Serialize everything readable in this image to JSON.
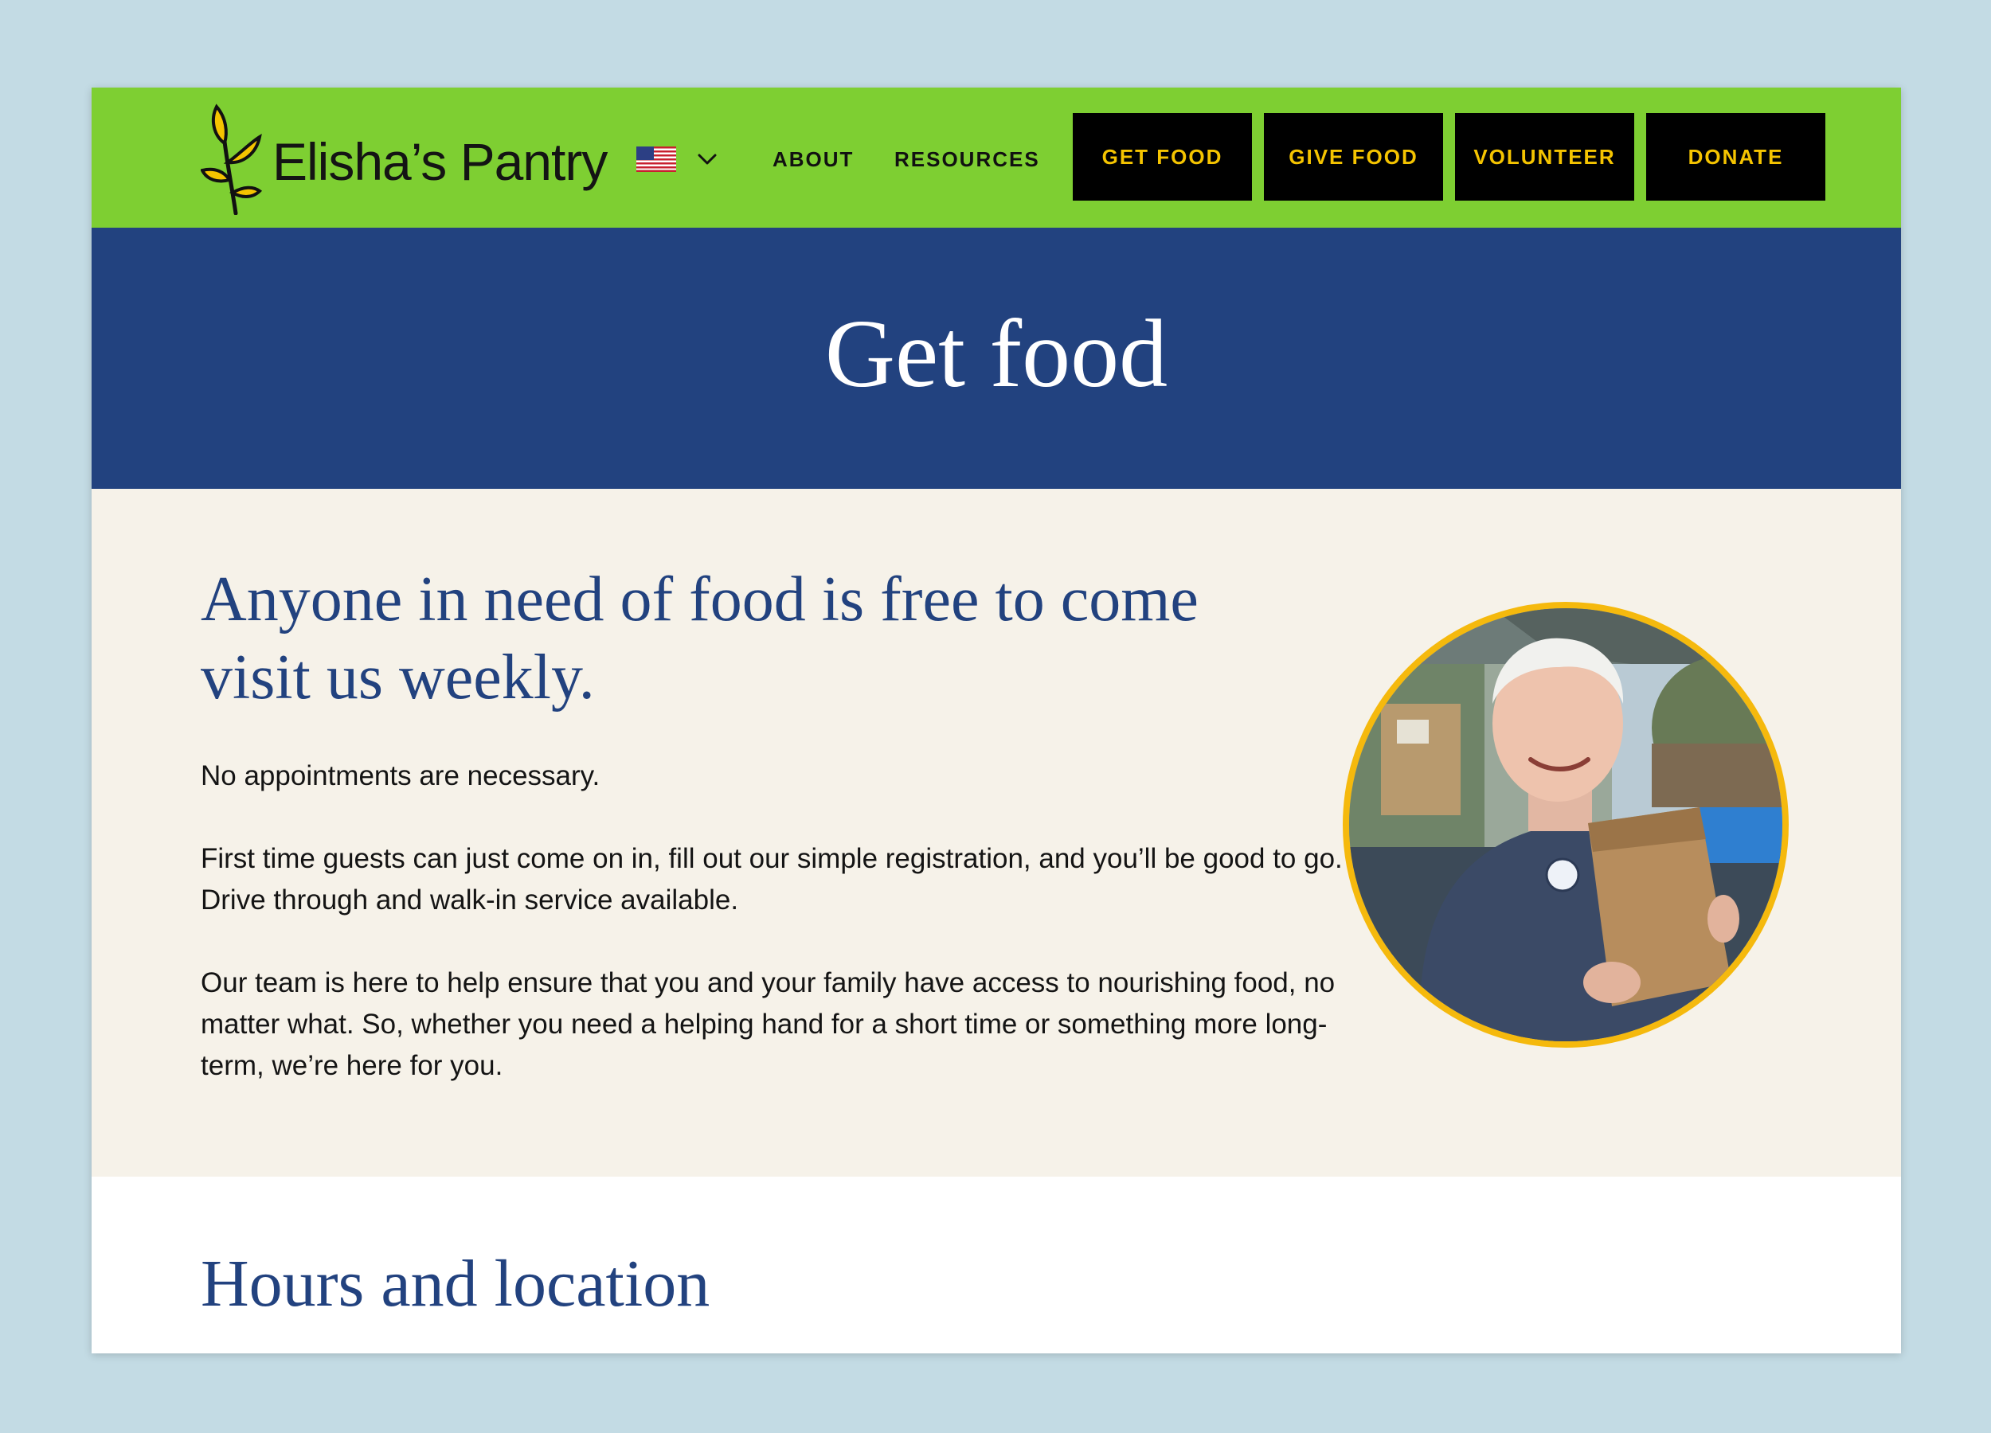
{
  "header": {
    "logo_text": "Elisha’s Pantry",
    "language": {
      "flag": "us-flag-icon",
      "chevron": "chevron-down-icon"
    },
    "nav_links": [
      "ABOUT",
      "RESOURCES"
    ],
    "nav_buttons": [
      "GET FOOD",
      "GIVE FOOD",
      "VOLUNTEER",
      "DONATE"
    ]
  },
  "hero": {
    "title": "Get food"
  },
  "intro": {
    "heading": "Anyone in need of food is free to come visit us weekly.",
    "paragraphs": [
      "No appointments are necessary.",
      "First time guests can just come on in, fill out our simple registration, and you’ll be good to go. Drive through and walk-in service available.",
      "Our team is here to help ensure that you and your family have access to nourishing food, no matter what. So, whether you need a helping hand for a short time or something more long-term, we’re here for you."
    ]
  },
  "hours": {
    "heading": "Hours and location"
  },
  "colors": {
    "header_green": "#7ecf32",
    "hero_blue": "#22427f",
    "intro_bg": "#f6f2e9",
    "button_text_yellow": "#f5c400",
    "photo_ring": "#f5b90d",
    "page_bg": "#c3dbe4"
  }
}
